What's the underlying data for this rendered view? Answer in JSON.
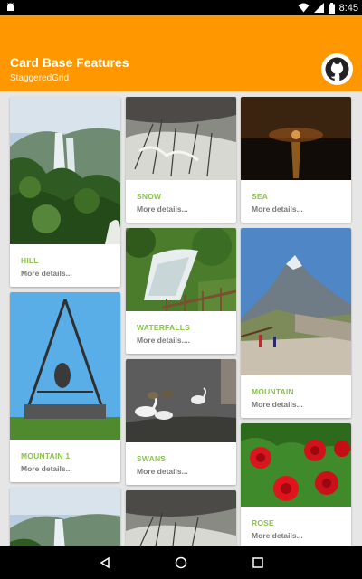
{
  "status_bar": {
    "time": "8:45",
    "icons": [
      "android-debug-icon",
      "wifi-icon",
      "signal-icon",
      "battery-icon"
    ]
  },
  "toolbar": {
    "title": "Card Base Features",
    "subtitle": "StaggeredGrid",
    "action_icon": "github-icon"
  },
  "theme": {
    "primary": "#ff9800",
    "accent": "#8bc34a",
    "background": "#e6e6e6"
  },
  "cards": [
    {
      "title": "HILL",
      "details": "More details..."
    },
    {
      "title": "SNOW",
      "details": "More details..."
    },
    {
      "title": "SEA",
      "details": "More details..."
    },
    {
      "title": "WATERFALLS",
      "details": "More details...."
    },
    {
      "title": "MOUNTAIN",
      "details": "More details..."
    },
    {
      "title": "MOUNTAIN 1",
      "details": "More details..."
    },
    {
      "title": "SWANS",
      "details": "More details..."
    },
    {
      "title": "ROSE",
      "details": "More details..."
    }
  ],
  "nav_bar": {
    "icons": [
      "back-icon",
      "home-icon",
      "recents-icon"
    ]
  }
}
